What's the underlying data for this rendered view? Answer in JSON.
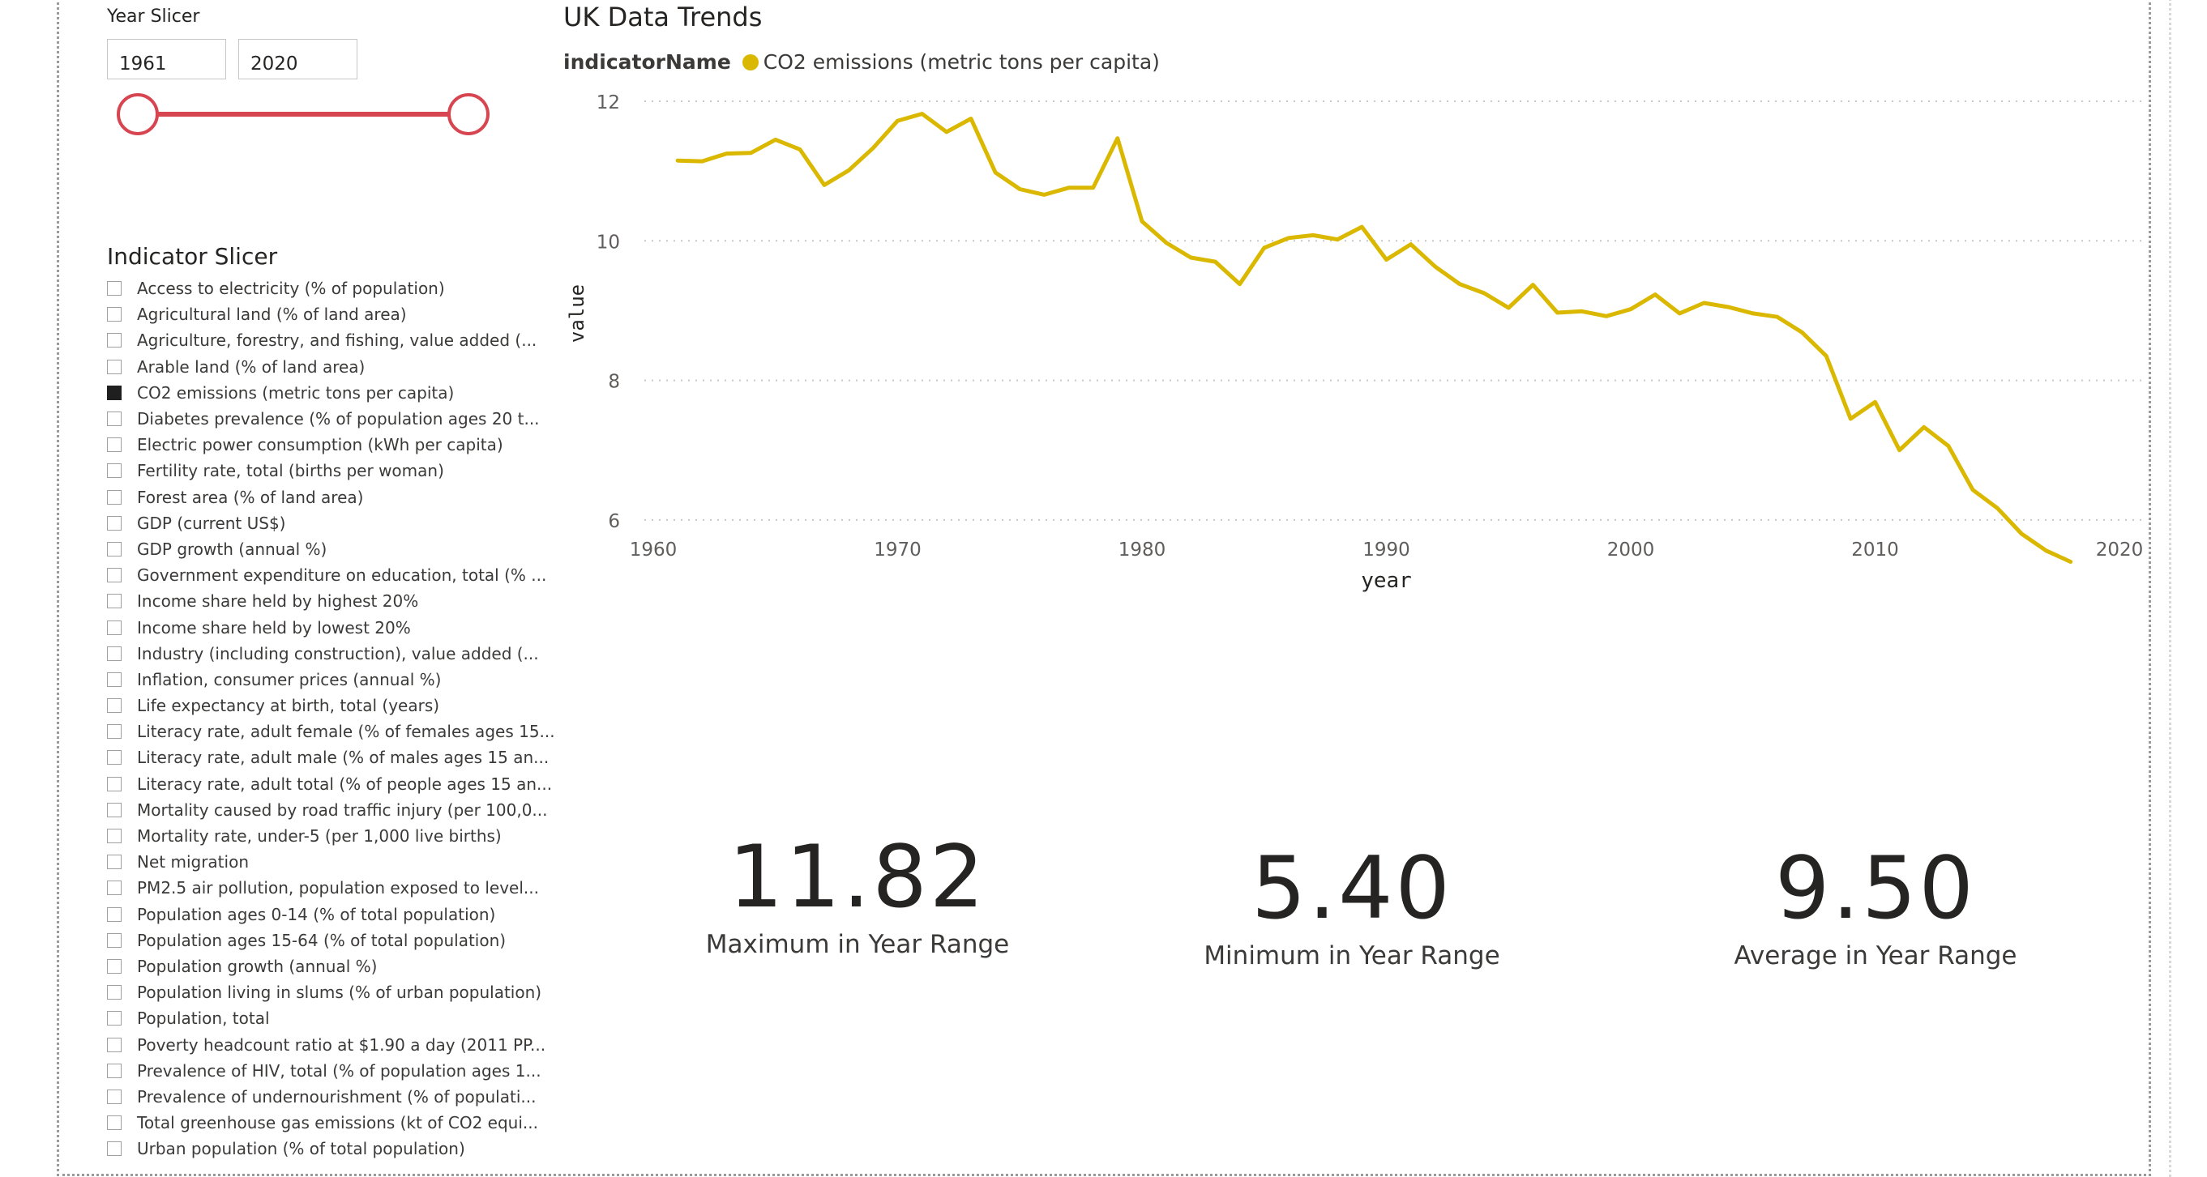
{
  "year_slicer": {
    "title": "Year Slicer",
    "start": "1961",
    "end": "2020",
    "accent_color": "#d64550"
  },
  "indicator_slicer": {
    "title": "Indicator Slicer",
    "items": [
      {
        "label": "Access to electricity (% of population)",
        "checked": false
      },
      {
        "label": "Agricultural land (% of land area)",
        "checked": false
      },
      {
        "label": "Agriculture, forestry, and fishing, value added (...",
        "checked": false
      },
      {
        "label": "Arable land (% of land area)",
        "checked": false
      },
      {
        "label": "CO2 emissions (metric tons per capita)",
        "checked": true
      },
      {
        "label": "Diabetes prevalence (% of population ages 20 t...",
        "checked": false
      },
      {
        "label": "Electric power consumption (kWh per capita)",
        "checked": false
      },
      {
        "label": "Fertility rate, total (births per woman)",
        "checked": false
      },
      {
        "label": "Forest area (% of land area)",
        "checked": false
      },
      {
        "label": "GDP (current US$)",
        "checked": false
      },
      {
        "label": "GDP growth (annual %)",
        "checked": false
      },
      {
        "label": "Government expenditure on education, total (% ...",
        "checked": false
      },
      {
        "label": "Income share held by highest 20%",
        "checked": false
      },
      {
        "label": "Income share held by lowest 20%",
        "checked": false
      },
      {
        "label": "Industry (including construction), value added (...",
        "checked": false
      },
      {
        "label": "Inflation, consumer prices (annual %)",
        "checked": false
      },
      {
        "label": "Life expectancy at birth, total (years)",
        "checked": false
      },
      {
        "label": "Literacy rate, adult female (% of females ages 15...",
        "checked": false
      },
      {
        "label": "Literacy rate, adult male (% of males ages 15 an...",
        "checked": false
      },
      {
        "label": "Literacy rate, adult total (% of people ages 15 an...",
        "checked": false
      },
      {
        "label": "Mortality caused by road traffic injury (per 100,0...",
        "checked": false
      },
      {
        "label": "Mortality rate, under-5 (per 1,000 live births)",
        "checked": false
      },
      {
        "label": "Net migration",
        "checked": false
      },
      {
        "label": "PM2.5 air pollution, population exposed to level...",
        "checked": false
      },
      {
        "label": "Population ages 0-14 (% of total population)",
        "checked": false
      },
      {
        "label": "Population ages 15-64 (% of total population)",
        "checked": false
      },
      {
        "label": "Population growth (annual %)",
        "checked": false
      },
      {
        "label": "Population living in slums (% of urban population)",
        "checked": false
      },
      {
        "label": "Population, total",
        "checked": false
      },
      {
        "label": "Poverty headcount ratio at $1.90 a day (2011 PP...",
        "checked": false
      },
      {
        "label": "Prevalence of HIV, total (% of population ages 1...",
        "checked": false
      },
      {
        "label": "Prevalence of undernourishment (% of populati...",
        "checked": false
      },
      {
        "label": "Total greenhouse gas emissions (kt of CO2 equi...",
        "checked": false
      },
      {
        "label": "Urban population (% of total population)",
        "checked": false
      }
    ]
  },
  "chart_data": {
    "type": "line",
    "title": "UK Data Trends",
    "legend_title": "indicatorName",
    "legend_placement": "top-left",
    "xlabel": "year",
    "ylabel": "value",
    "xlim": [
      1960,
      2020
    ],
    "ylim": [
      5,
      12
    ],
    "x_ticks": [
      1960,
      1970,
      1980,
      1990,
      2000,
      2010,
      2020
    ],
    "y_ticks": [
      6,
      8,
      10,
      12
    ],
    "grid": true,
    "series": [
      {
        "name": "CO2 emissions (metric tons per capita)",
        "color": "#dbb800",
        "x": [
          1961,
          1962,
          1963,
          1964,
          1965,
          1966,
          1967,
          1968,
          1969,
          1970,
          1971,
          1972,
          1973,
          1974,
          1975,
          1976,
          1977,
          1978,
          1979,
          1980,
          1981,
          1982,
          1983,
          1984,
          1985,
          1986,
          1987,
          1988,
          1989,
          1990,
          1991,
          1992,
          1993,
          1994,
          1995,
          1996,
          1997,
          1998,
          1999,
          2000,
          2001,
          2002,
          2003,
          2004,
          2005,
          2006,
          2007,
          2008,
          2009,
          2010,
          2011,
          2012,
          2013,
          2014,
          2015,
          2016,
          2017,
          2018
        ],
        "y": [
          11.15,
          11.14,
          11.25,
          11.26,
          11.45,
          11.31,
          10.8,
          11.01,
          11.33,
          11.72,
          11.82,
          11.56,
          11.75,
          10.98,
          10.74,
          10.66,
          10.76,
          10.76,
          11.47,
          10.28,
          9.97,
          9.76,
          9.7,
          9.38,
          9.9,
          10.04,
          10.08,
          10.02,
          10.2,
          9.73,
          9.95,
          9.63,
          9.38,
          9.25,
          9.04,
          9.37,
          8.97,
          8.99,
          8.92,
          9.02,
          9.23,
          8.96,
          9.11,
          9.05,
          8.96,
          8.91,
          8.69,
          8.35,
          7.45,
          7.69,
          7.0,
          7.33,
          7.06,
          6.43,
          6.17,
          5.8,
          5.56,
          5.4
        ]
      }
    ]
  },
  "cards": {
    "max": {
      "value": "11.82",
      "label": "Maximum in Year Range"
    },
    "min": {
      "value": "5.40",
      "label": "Minimum in Year Range"
    },
    "avg": {
      "value": "9.50",
      "label": "Average in Year Range"
    }
  }
}
